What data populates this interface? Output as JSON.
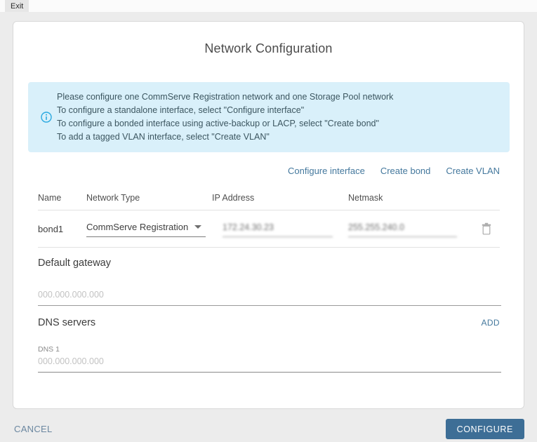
{
  "exit_tab": "Exit",
  "dialog": {
    "title": "Network Configuration"
  },
  "info": {
    "lines": [
      "Please configure one CommServe Registration network and one Storage Pool network",
      "To configure a standalone interface, select \"Configure interface\"",
      "To configure a bonded interface using active-backup or LACP, select \"Create bond\"",
      "To add a tagged VLAN interface, select \"Create VLAN\""
    ]
  },
  "actions": {
    "configure_interface": "Configure interface",
    "create_bond": "Create bond",
    "create_vlan": "Create VLAN"
  },
  "table": {
    "headers": [
      "Name",
      "Network Type",
      "IP Address",
      "Netmask"
    ],
    "row": {
      "name": "bond1",
      "network_type": "CommServe Registration",
      "ip_address": "172.24.30.23",
      "netmask": "255.255.240.0"
    }
  },
  "gateway": {
    "label": "Default gateway",
    "placeholder": "000.000.000.000"
  },
  "dns": {
    "label": "DNS servers",
    "add_label": "ADD",
    "field_label": "DNS 1",
    "placeholder": "000.000.000.000"
  },
  "footer": {
    "cancel_label": "CANCEL",
    "configure_label": "CONFIGURE"
  },
  "colors": {
    "accent_link": "#44789d",
    "info_icon_blue": "#2aa9e0",
    "info_banner_bg": "#d9f0fa",
    "configure_button_bg": "#3d6e96"
  }
}
